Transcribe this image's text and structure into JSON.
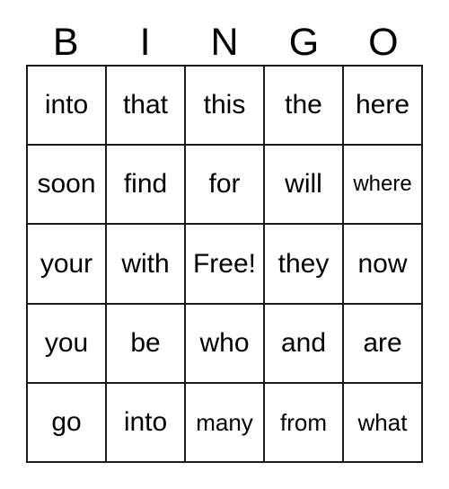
{
  "card": {
    "title": "BINGO",
    "headers": [
      "B",
      "I",
      "N",
      "G",
      "O"
    ],
    "free_space_label": "Free!",
    "grid_colors": {
      "line": "#1a1a1a",
      "cell_background": "#ffffff",
      "text": "#000000",
      "page_background": "#ffffff"
    },
    "rows": [
      [
        {
          "text": "into",
          "size": "normal",
          "free": false
        },
        {
          "text": "that",
          "size": "normal",
          "free": false
        },
        {
          "text": "this",
          "size": "normal",
          "free": false
        },
        {
          "text": "the",
          "size": "normal",
          "free": false
        },
        {
          "text": "here",
          "size": "normal",
          "free": false
        }
      ],
      [
        {
          "text": "soon",
          "size": "normal",
          "free": false
        },
        {
          "text": "find",
          "size": "normal",
          "free": false
        },
        {
          "text": "for",
          "size": "normal",
          "free": false
        },
        {
          "text": "will",
          "size": "normal",
          "free": false
        },
        {
          "text": "where",
          "size": "small",
          "free": false
        }
      ],
      [
        {
          "text": "your",
          "size": "normal",
          "free": false
        },
        {
          "text": "with",
          "size": "normal",
          "free": false
        },
        {
          "text": "Free!",
          "size": "normal",
          "free": true
        },
        {
          "text": "they",
          "size": "normal",
          "free": false
        },
        {
          "text": "now",
          "size": "normal",
          "free": false
        }
      ],
      [
        {
          "text": "you",
          "size": "normal",
          "free": false
        },
        {
          "text": "be",
          "size": "normal",
          "free": false
        },
        {
          "text": "who",
          "size": "normal",
          "free": false
        },
        {
          "text": "and",
          "size": "normal",
          "free": false
        },
        {
          "text": "are",
          "size": "normal",
          "free": false
        }
      ],
      [
        {
          "text": "go",
          "size": "normal",
          "free": false
        },
        {
          "text": "into",
          "size": "normal",
          "free": false
        },
        {
          "text": "many",
          "size": "medium",
          "free": false
        },
        {
          "text": "from",
          "size": "medium",
          "free": false
        },
        {
          "text": "what",
          "size": "medium",
          "free": false
        }
      ]
    ]
  }
}
